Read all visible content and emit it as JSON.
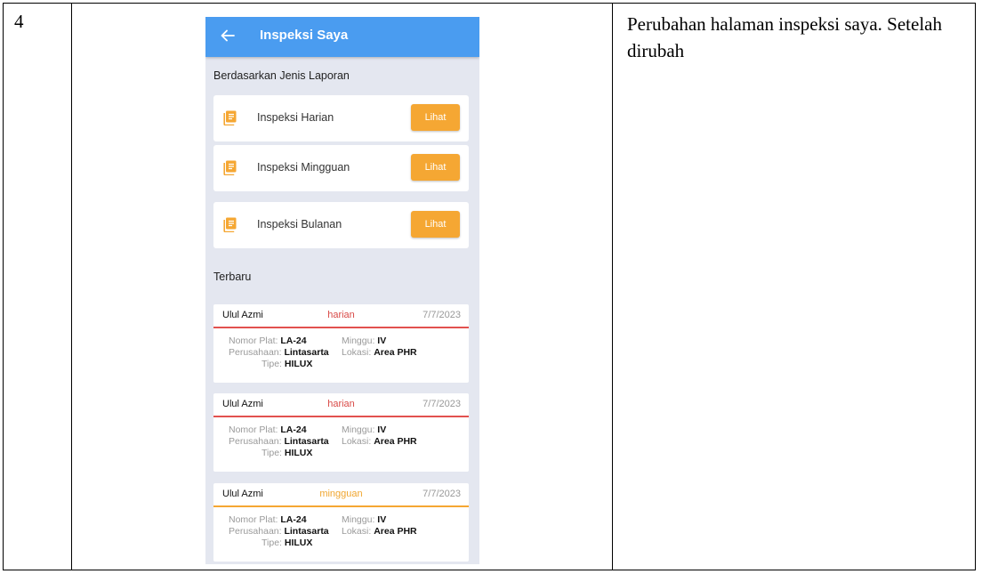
{
  "row_number": "4",
  "description": "Perubahan halaman inspeksi saya. Setelah dirubah",
  "app": {
    "title": "Inspeksi Saya",
    "section_types": "Berdasarkan Jenis Laporan",
    "section_recent": "Terbaru",
    "types": [
      {
        "label": "Inspeksi Harian",
        "button": "Lihat"
      },
      {
        "label": "Inspeksi Mingguan",
        "button": "Lihat"
      },
      {
        "label": "Inspeksi Bulanan",
        "button": "Lihat"
      }
    ],
    "labels": {
      "plate": "Nomor Plat:",
      "week": "Minggu:",
      "company": "Perusahaan:",
      "location": "Lokasi:",
      "type": "Tipe:"
    },
    "recent": [
      {
        "name": "Ulul Azmi",
        "kind": "harian",
        "date": "7/7/2023",
        "plate": "LA-24",
        "week": "IV",
        "company": "Lintasarta",
        "location": "Area PHR",
        "vehicle": "HILUX"
      },
      {
        "name": "Ulul Azmi",
        "kind": "harian",
        "date": "7/7/2023",
        "plate": "LA-24",
        "week": "IV",
        "company": "Lintasarta",
        "location": "Area PHR",
        "vehicle": "HILUX"
      },
      {
        "name": "Ulul Azmi",
        "kind": "mingguan",
        "date": "7/7/2023",
        "plate": "LA-24",
        "week": "IV",
        "company": "Lintasarta",
        "location": "Area PHR",
        "vehicle": "HILUX"
      }
    ],
    "colors": {
      "appbar": "#4a9cf0",
      "button": "#f5a733",
      "harian": "#e2514f",
      "mingguan": "#f5a733"
    },
    "icons": {
      "back": "arrow-left-icon",
      "report": "document-list-icon"
    }
  }
}
